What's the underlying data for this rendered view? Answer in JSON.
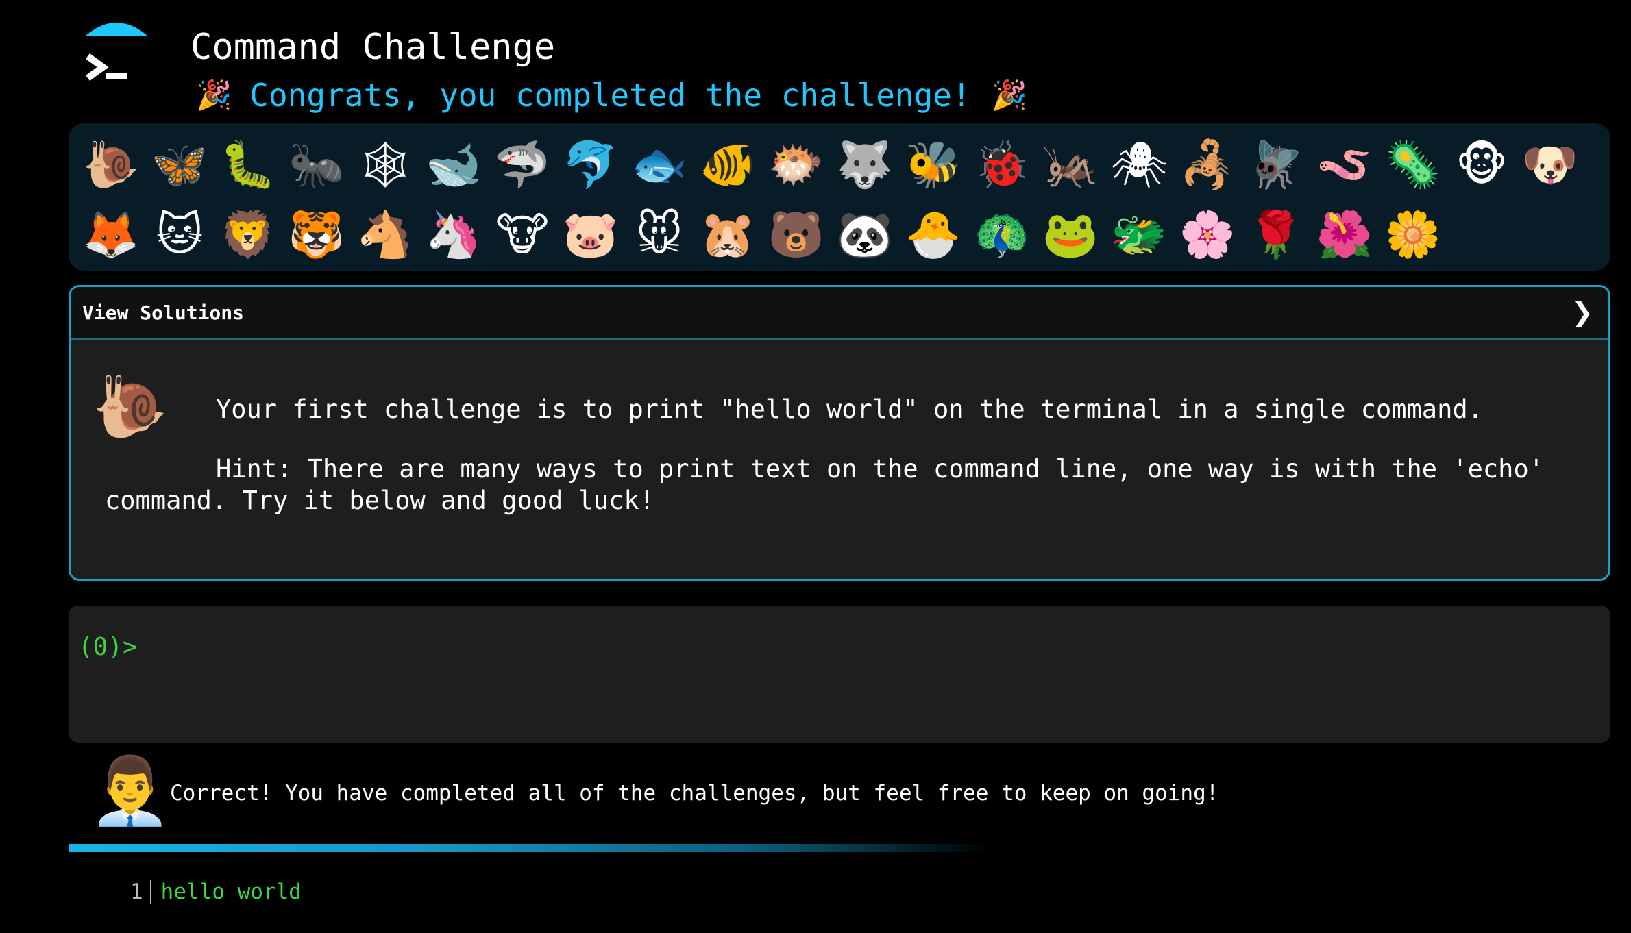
{
  "header": {
    "title": "Command Challenge",
    "congrats_text": "Congrats, you completed the challenge!",
    "party_icon": "🎉",
    "accent_color": "#1ec8ff"
  },
  "badges": {
    "row1": [
      "🐌",
      "🦋",
      "🐛",
      "🐜",
      "🕸",
      "🐋",
      "🦈",
      "🐬",
      "🐟",
      "🐠",
      "🐡",
      "🐺",
      "🐝",
      "🐞",
      "🦗",
      "🕷",
      "🦂",
      "🪰",
      "🪱",
      "🦠",
      "🐵",
      "🐶"
    ],
    "row2": [
      "🦊",
      "🐱",
      "🦁",
      "🐯",
      "🐴",
      "🦄",
      "🐮",
      "🐷",
      "🐭",
      "🐹",
      "🐻",
      "🐼",
      "🐣",
      "🦚",
      "🐸",
      "🐲",
      "🌸",
      "🌹",
      "🌺",
      "🌼"
    ]
  },
  "solutions": {
    "title": "View Solutions",
    "chevron": "❯",
    "icon": "🐌",
    "challenge": "Your first challenge is to print \"hello world\" on the terminal in a single command.",
    "hint": "Hint: There are many ways to print text on the command line, one way is with the 'echo' command. Try it below and good luck!"
  },
  "terminal": {
    "prompt": "(0)>",
    "prompt_color": "#3ed63e"
  },
  "result": {
    "avatar": "👨‍💼",
    "message": "Correct! You have completed all of the challenges, but feel free to keep on going!",
    "progress_fraction": 1.0
  },
  "output": {
    "lines": [
      {
        "number": "1",
        "text": "hello world"
      }
    ]
  }
}
